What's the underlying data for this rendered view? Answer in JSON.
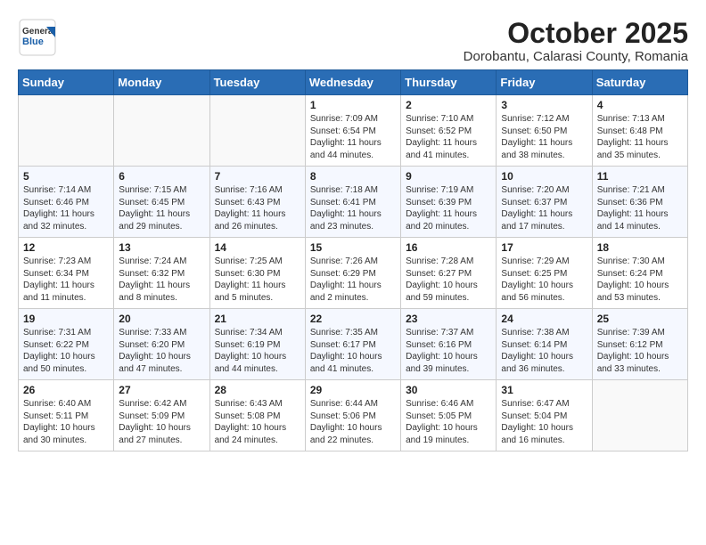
{
  "header": {
    "logo_general": "General",
    "logo_blue": "Blue",
    "month_title": "October 2025",
    "subtitle": "Dorobantu, Calarasi County, Romania"
  },
  "weekdays": [
    "Sunday",
    "Monday",
    "Tuesday",
    "Wednesday",
    "Thursday",
    "Friday",
    "Saturday"
  ],
  "weeks": [
    [
      {
        "day": "",
        "text": ""
      },
      {
        "day": "",
        "text": ""
      },
      {
        "day": "",
        "text": ""
      },
      {
        "day": "1",
        "text": "Sunrise: 7:09 AM\nSunset: 6:54 PM\nDaylight: 11 hours and 44 minutes."
      },
      {
        "day": "2",
        "text": "Sunrise: 7:10 AM\nSunset: 6:52 PM\nDaylight: 11 hours and 41 minutes."
      },
      {
        "day": "3",
        "text": "Sunrise: 7:12 AM\nSunset: 6:50 PM\nDaylight: 11 hours and 38 minutes."
      },
      {
        "day": "4",
        "text": "Sunrise: 7:13 AM\nSunset: 6:48 PM\nDaylight: 11 hours and 35 minutes."
      }
    ],
    [
      {
        "day": "5",
        "text": "Sunrise: 7:14 AM\nSunset: 6:46 PM\nDaylight: 11 hours and 32 minutes."
      },
      {
        "day": "6",
        "text": "Sunrise: 7:15 AM\nSunset: 6:45 PM\nDaylight: 11 hours and 29 minutes."
      },
      {
        "day": "7",
        "text": "Sunrise: 7:16 AM\nSunset: 6:43 PM\nDaylight: 11 hours and 26 minutes."
      },
      {
        "day": "8",
        "text": "Sunrise: 7:18 AM\nSunset: 6:41 PM\nDaylight: 11 hours and 23 minutes."
      },
      {
        "day": "9",
        "text": "Sunrise: 7:19 AM\nSunset: 6:39 PM\nDaylight: 11 hours and 20 minutes."
      },
      {
        "day": "10",
        "text": "Sunrise: 7:20 AM\nSunset: 6:37 PM\nDaylight: 11 hours and 17 minutes."
      },
      {
        "day": "11",
        "text": "Sunrise: 7:21 AM\nSunset: 6:36 PM\nDaylight: 11 hours and 14 minutes."
      }
    ],
    [
      {
        "day": "12",
        "text": "Sunrise: 7:23 AM\nSunset: 6:34 PM\nDaylight: 11 hours and 11 minutes."
      },
      {
        "day": "13",
        "text": "Sunrise: 7:24 AM\nSunset: 6:32 PM\nDaylight: 11 hours and 8 minutes."
      },
      {
        "day": "14",
        "text": "Sunrise: 7:25 AM\nSunset: 6:30 PM\nDaylight: 11 hours and 5 minutes."
      },
      {
        "day": "15",
        "text": "Sunrise: 7:26 AM\nSunset: 6:29 PM\nDaylight: 11 hours and 2 minutes."
      },
      {
        "day": "16",
        "text": "Sunrise: 7:28 AM\nSunset: 6:27 PM\nDaylight: 10 hours and 59 minutes."
      },
      {
        "day": "17",
        "text": "Sunrise: 7:29 AM\nSunset: 6:25 PM\nDaylight: 10 hours and 56 minutes."
      },
      {
        "day": "18",
        "text": "Sunrise: 7:30 AM\nSunset: 6:24 PM\nDaylight: 10 hours and 53 minutes."
      }
    ],
    [
      {
        "day": "19",
        "text": "Sunrise: 7:31 AM\nSunset: 6:22 PM\nDaylight: 10 hours and 50 minutes."
      },
      {
        "day": "20",
        "text": "Sunrise: 7:33 AM\nSunset: 6:20 PM\nDaylight: 10 hours and 47 minutes."
      },
      {
        "day": "21",
        "text": "Sunrise: 7:34 AM\nSunset: 6:19 PM\nDaylight: 10 hours and 44 minutes."
      },
      {
        "day": "22",
        "text": "Sunrise: 7:35 AM\nSunset: 6:17 PM\nDaylight: 10 hours and 41 minutes."
      },
      {
        "day": "23",
        "text": "Sunrise: 7:37 AM\nSunset: 6:16 PM\nDaylight: 10 hours and 39 minutes."
      },
      {
        "day": "24",
        "text": "Sunrise: 7:38 AM\nSunset: 6:14 PM\nDaylight: 10 hours and 36 minutes."
      },
      {
        "day": "25",
        "text": "Sunrise: 7:39 AM\nSunset: 6:12 PM\nDaylight: 10 hours and 33 minutes."
      }
    ],
    [
      {
        "day": "26",
        "text": "Sunrise: 6:40 AM\nSunset: 5:11 PM\nDaylight: 10 hours and 30 minutes."
      },
      {
        "day": "27",
        "text": "Sunrise: 6:42 AM\nSunset: 5:09 PM\nDaylight: 10 hours and 27 minutes."
      },
      {
        "day": "28",
        "text": "Sunrise: 6:43 AM\nSunset: 5:08 PM\nDaylight: 10 hours and 24 minutes."
      },
      {
        "day": "29",
        "text": "Sunrise: 6:44 AM\nSunset: 5:06 PM\nDaylight: 10 hours and 22 minutes."
      },
      {
        "day": "30",
        "text": "Sunrise: 6:46 AM\nSunset: 5:05 PM\nDaylight: 10 hours and 19 minutes."
      },
      {
        "day": "31",
        "text": "Sunrise: 6:47 AM\nSunset: 5:04 PM\nDaylight: 10 hours and 16 minutes."
      },
      {
        "day": "",
        "text": ""
      }
    ]
  ]
}
